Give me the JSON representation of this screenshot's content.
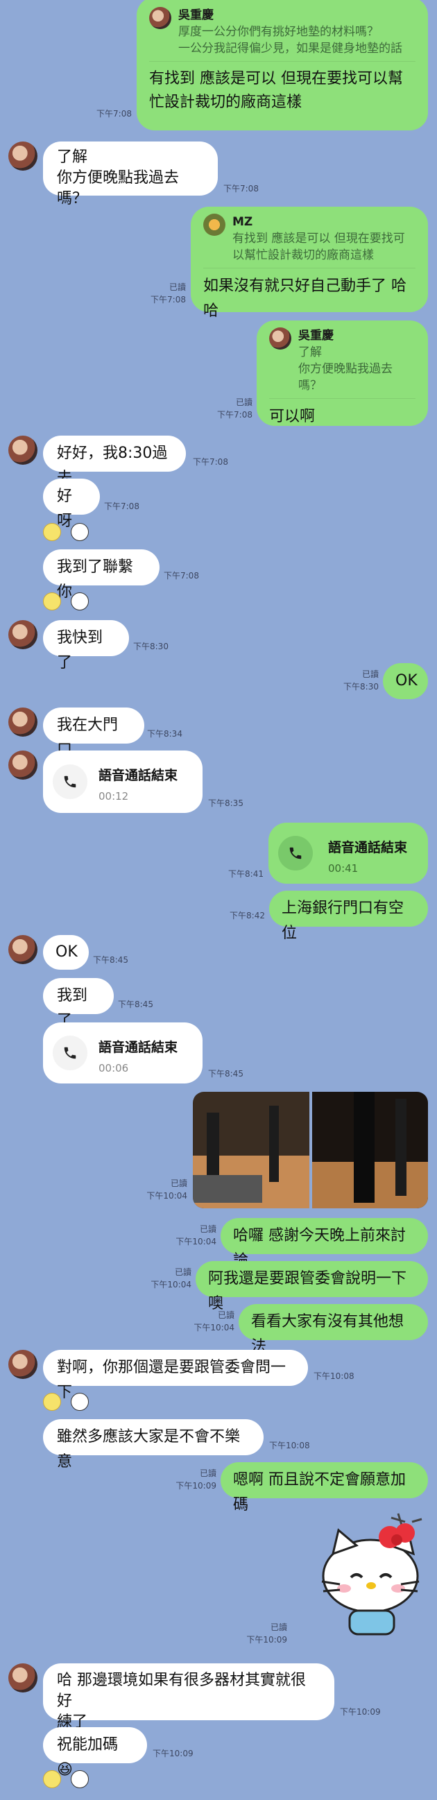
{
  "read_label": "已讀",
  "messages": [
    {
      "quote_name": "吳重慶",
      "quote_text": "厚度一公分你們有挑好地墊的材料嗎？\n一公分我記得偏少見，如果是健身地墊的話",
      "text": "有找到 應該是可以 但現在要找可以幫忙設計裁切的廠商這樣",
      "time": "下午7:08"
    },
    {
      "text_line1": "了解",
      "text_line2": "你方便晚點我過去嗎？",
      "time": "下午7:08"
    },
    {
      "quote_name": "MZ",
      "quote_text": "有找到 應該是可以 但現在要找可以幫忙設計裁切的廠商這樣",
      "text": "如果沒有就只好自己動手了 哈哈",
      "time": "下午7:08"
    },
    {
      "quote_name": "吳重慶",
      "quote_text": "了解\n你方便晚點我過去嗎？",
      "text": "可以啊",
      "time": "下午7:08"
    },
    {
      "text": "好好，我8:30過去",
      "time": "下午7:08"
    },
    {
      "text": "好呀",
      "time": "下午7:08"
    },
    {
      "text": "我到了聯繫你",
      "time": "下午7:08"
    },
    {
      "text": "我快到了",
      "time": "下午8:30"
    },
    {
      "text": "OK",
      "time": "下午8:30"
    },
    {
      "text": "我在大門口",
      "time": "下午8:34"
    },
    {
      "call_title": "語音通話結束",
      "call_duration": "00:12",
      "time": "下午8:35"
    },
    {
      "call_title": "語音通話結束",
      "call_duration": "00:41",
      "time": "下午8:41"
    },
    {
      "text": "上海銀行門口有空位",
      "time": "下午8:42"
    },
    {
      "text": "OK",
      "time": "下午8:45"
    },
    {
      "text": "我到了",
      "time": "下午8:45"
    },
    {
      "call_title": "語音通話結束",
      "call_duration": "00:06",
      "time": "下午8:45"
    },
    {
      "time": "下午10:04"
    },
    {
      "text": "哈囉 感謝今天晚上前來討論",
      "time": "下午10:04"
    },
    {
      "text": "阿我還是要跟管委會說明一下噢",
      "time": "下午10:04"
    },
    {
      "text": "看看大家有沒有其他想法",
      "time": "下午10:04"
    },
    {
      "text": "對啊，你那個還是要跟管委會問一下",
      "time": "下午10:08"
    },
    {
      "text": "雖然多應該大家是不會不樂意",
      "time": "下午10:08"
    },
    {
      "text": "嗯啊 而且說不定會願意加碼",
      "time": "下午10:09"
    },
    {
      "time": "下午10:09"
    },
    {
      "text_line1": "哈 那邊環境如果有很多器材其實就很好",
      "text_line2": "練了",
      "time": "下午10:09"
    },
    {
      "text": "祝能加碼😆",
      "time": "下午10:09"
    }
  ],
  "colors": {
    "background": "#8fa9d6",
    "incoming": "#ffffff",
    "outgoing": "#8ee07a"
  }
}
